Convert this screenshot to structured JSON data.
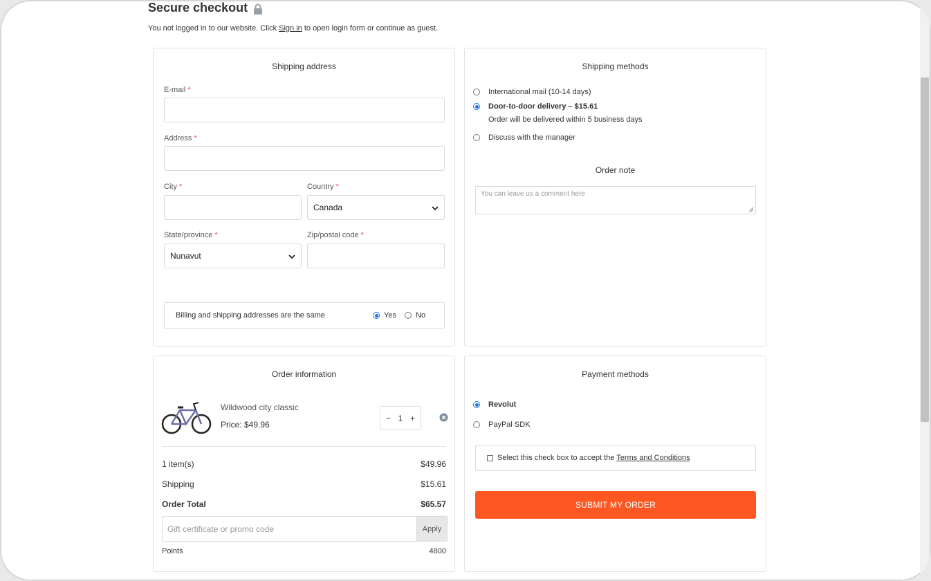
{
  "page": {
    "title": "Secure checkout",
    "subtitle_before": "You not logged in to our website. Click ",
    "sign_in_link": "Sign in",
    "subtitle_after": " to open login form or continue as guest."
  },
  "shipping_address": {
    "title": "Shipping address",
    "email_label": "E-mail",
    "address_label": "Address",
    "city_label": "City",
    "country_label": "Country",
    "country_value": "Canada",
    "state_label": "State/province",
    "state_value": "Nunavut",
    "zip_label": "Zip/postal code",
    "required_mark": "*",
    "billing_same_label": "Billing and shipping addresses are the same",
    "billing_yes": "Yes",
    "billing_no": "No",
    "billing_selected": "Yes"
  },
  "shipping_methods": {
    "title": "Shipping methods",
    "options": [
      {
        "label": "International mail (10-14 days)",
        "selected": false
      },
      {
        "label": "Door-to-door delivery – $15.61",
        "selected": true,
        "note": "Order will be delivered within 5 business days"
      },
      {
        "label": "Discuss with the manager",
        "selected": false
      }
    ],
    "order_note_title": "Order note",
    "order_note_placeholder": "You can leave us a comment here"
  },
  "order_information": {
    "title": "Order information",
    "item": {
      "name": "Wildwood city classic",
      "price": "Price: $49.96",
      "quantity": "1",
      "image_icon": "bicycle-icon"
    },
    "summary": [
      {
        "label": "1 item(s)",
        "value": "$49.96"
      },
      {
        "label": "Shipping",
        "value": "$15.61"
      },
      {
        "label": "Order Total",
        "value": "$65.57"
      }
    ],
    "promo_placeholder": "Gift certificate or promo code",
    "apply_label": "Apply",
    "points_label": "Points",
    "points_value": "4800"
  },
  "payment_methods": {
    "title": "Payment methods",
    "options": [
      {
        "label": "Revolut",
        "selected": true
      },
      {
        "label": "PayPal SDK",
        "selected": false
      }
    ],
    "terms_text": "Select this check box to accept the ",
    "terms_link": "Terms and Conditions",
    "submit_label": "SUBMIT MY ORDER"
  },
  "colors": {
    "accent": "#ff5722",
    "radio_selected": "#1a73e8",
    "required": "#e74c3c"
  }
}
